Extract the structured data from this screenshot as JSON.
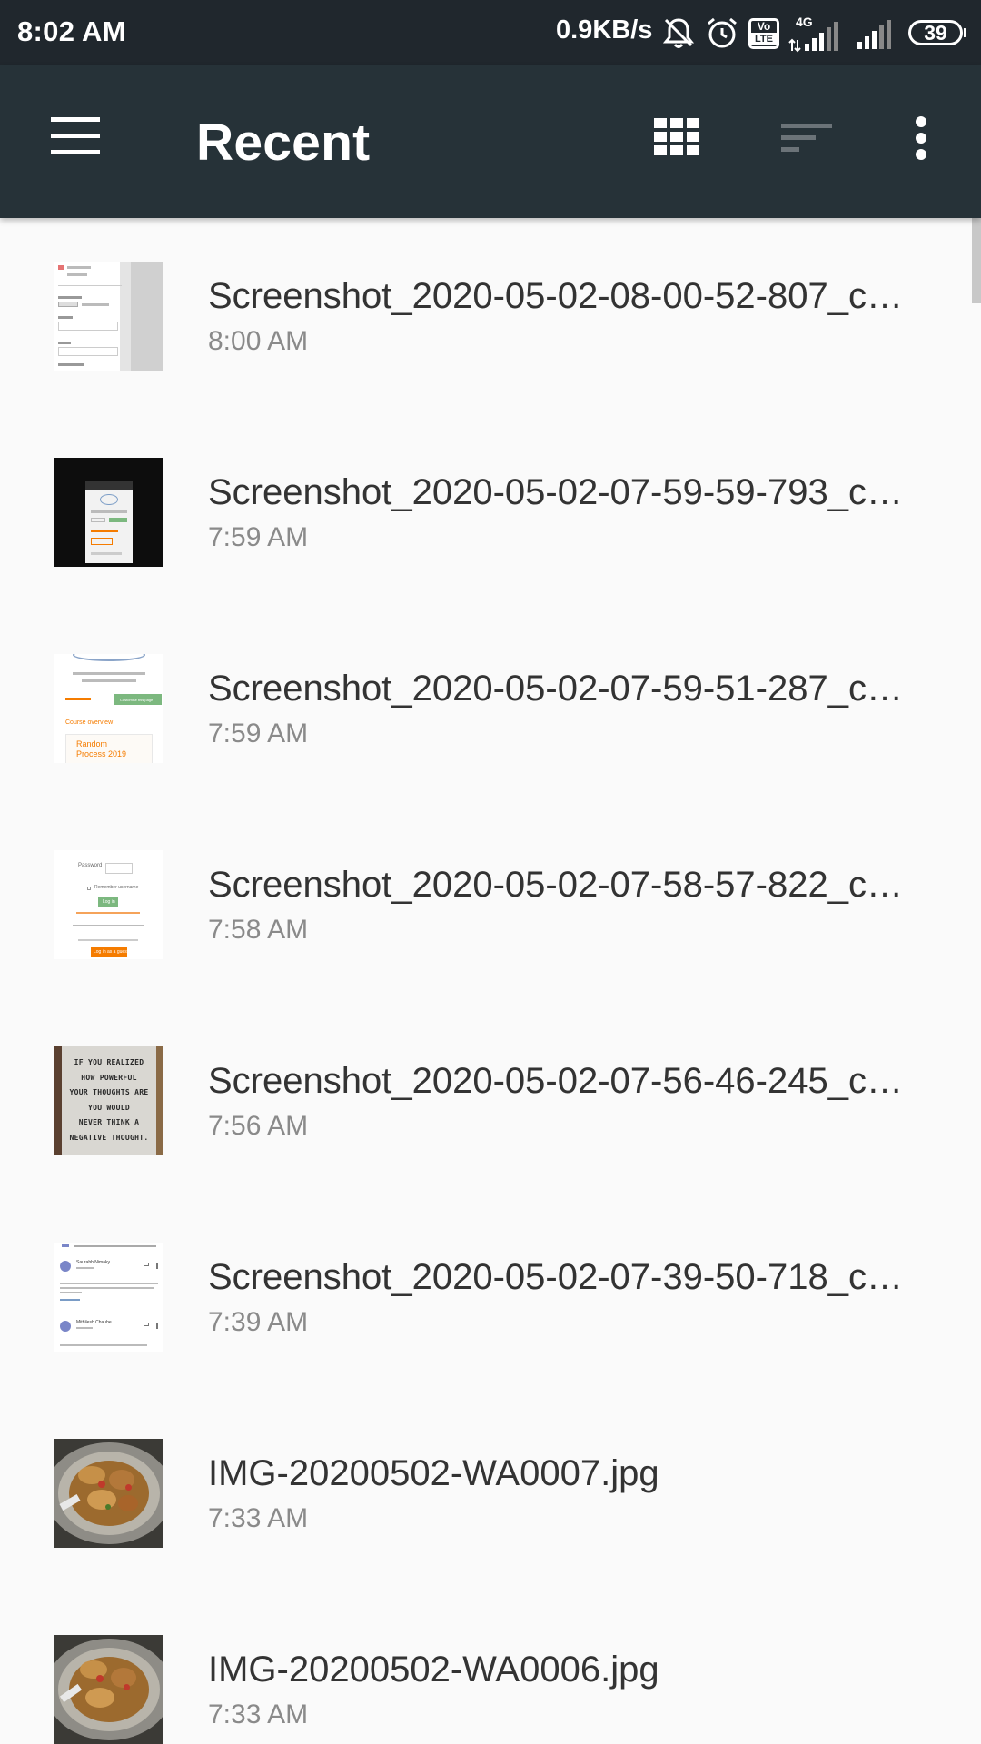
{
  "status_bar": {
    "time": "8:02 AM",
    "network_speed": "0.9KB/s",
    "icons": [
      "bell-muted-icon",
      "alarm-icon",
      "volte-icon",
      "signal-4g-icon",
      "signal-icon",
      "battery-icon"
    ],
    "network_type": "4G",
    "volte_label_top": "Vo",
    "volte_label_bottom": "LTE",
    "battery_level": "39"
  },
  "toolbar": {
    "title": "Recent",
    "icons": [
      "menu-icon",
      "grid-view-icon",
      "sort-icon",
      "more-vert-icon"
    ]
  },
  "files": [
    {
      "name": "Screenshot_2020-05-02-08-00-52-807_co...",
      "time": "8:00 AM",
      "thumb": "screenshot-form"
    },
    {
      "name": "Screenshot_2020-05-02-07-59-59-793_co...",
      "time": "7:59 AM",
      "thumb": "screenshot-dark"
    },
    {
      "name": "Screenshot_2020-05-02-07-59-51-287_co...",
      "time": "7:59 AM",
      "thumb": "screenshot-course"
    },
    {
      "name": "Screenshot_2020-05-02-07-58-57-822_co...",
      "time": "7:58 AM",
      "thumb": "screenshot-login"
    },
    {
      "name": "Screenshot_2020-05-02-07-56-46-245_co...",
      "time": "7:56 AM",
      "thumb": "photo-letterboard"
    },
    {
      "name": "Screenshot_2020-05-02-07-39-50-718_co...",
      "time": "7:39 AM",
      "thumb": "screenshot-email"
    },
    {
      "name": "IMG-20200502-WA0007.jpg",
      "time": "7:33 AM",
      "thumb": "photo-food"
    },
    {
      "name": "IMG-20200502-WA0006.jpg",
      "time": "7:33 AM",
      "thumb": "photo-food"
    }
  ],
  "thumb_text": {
    "course_button": "Customise this page",
    "course_heading": "Course overview",
    "course_title": "Random Process 2019",
    "login_password": "Password",
    "login_remember": "Remember username",
    "login_button": "Log in",
    "login_guest": "Log in as a guest",
    "letterboard_lines": [
      "IF YOU REALIZED",
      "HOW POWERFUL",
      "YOUR THOUGHTS ARE",
      "YOU WOULD",
      "NEVER THINK A",
      "NEGATIVE THOUGHT."
    ],
    "email_sender_1": "Saurabh Nimaky",
    "email_sender_2": "Mithilesh Chaube"
  },
  "colors": {
    "status_bar": "#20272d",
    "toolbar": "#263238",
    "background": "#fafafa",
    "title_text": "#333333",
    "secondary_text": "#8a8a8a",
    "accent_orange": "#f57c00",
    "accent_green": "#7cb87f"
  }
}
